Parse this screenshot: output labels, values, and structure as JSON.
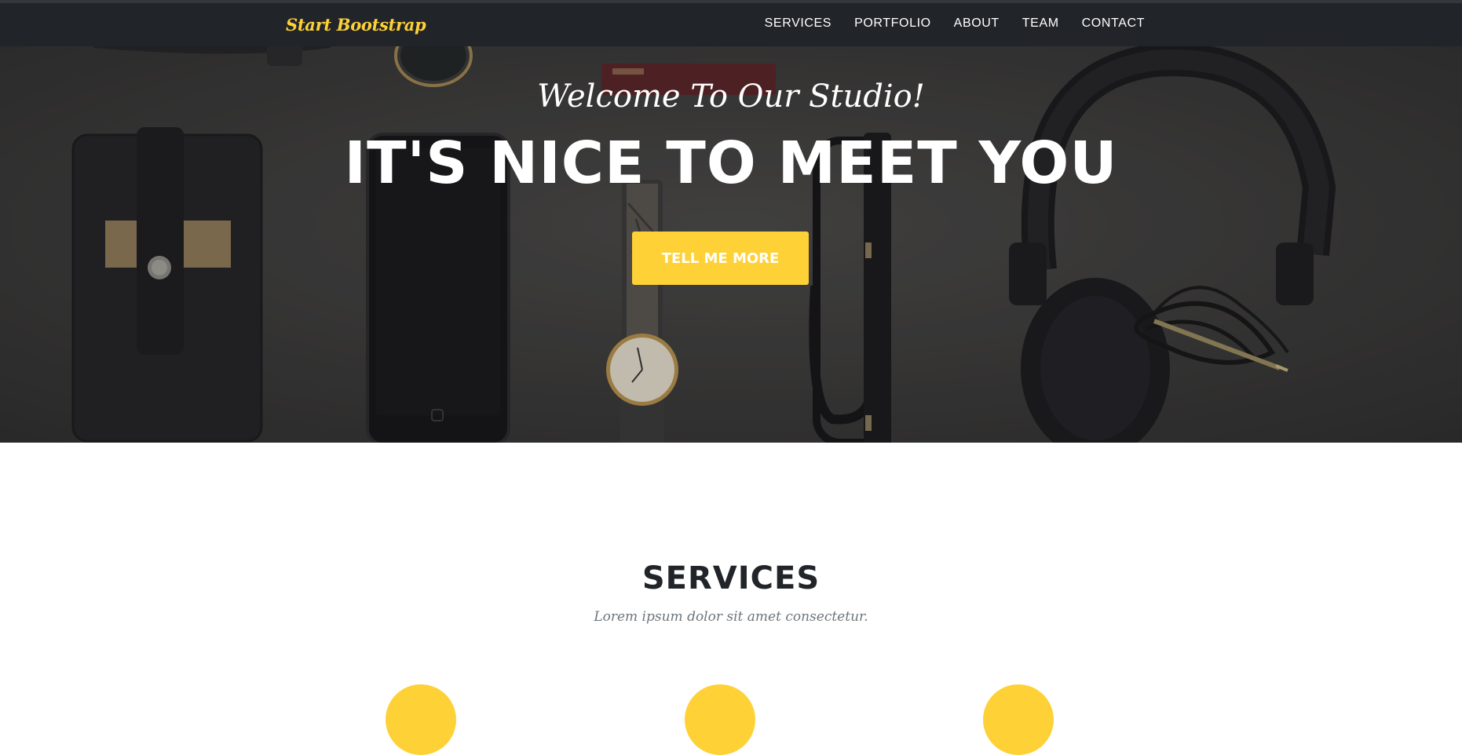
{
  "navbar": {
    "brand": "Start Bootstrap",
    "links": [
      "SERVICES",
      "PORTFOLIO",
      "ABOUT",
      "TEAM",
      "CONTACT"
    ]
  },
  "hero": {
    "subheading": "Welcome To Our Studio!",
    "heading": "IT'S NICE TO MEET YOU",
    "button_label": "TELL ME MORE"
  },
  "services": {
    "heading": "SERVICES",
    "subheading": "Lorem ipsum dolor sit amet consectetur."
  },
  "colors": {
    "accent": "#fed136",
    "navbar": "#212529",
    "heading_text": "#212529",
    "muted_text": "#6c757d"
  }
}
